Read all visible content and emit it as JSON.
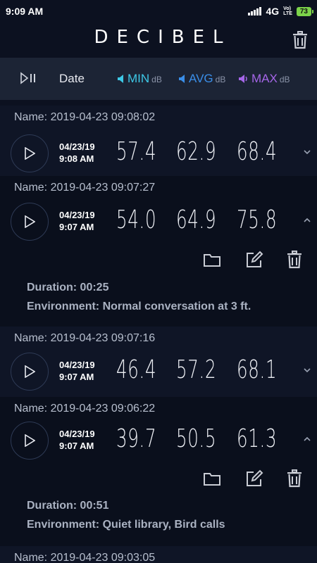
{
  "status_bar": {
    "time": "9:09 AM",
    "network": "4G",
    "volte_line1": "Vo)",
    "volte_line2": "LTE",
    "battery": "73"
  },
  "header": {
    "app_title": "DECIBEL"
  },
  "columns": {
    "date_label": "Date",
    "min_label": "MIN",
    "avg_label": "AVG",
    "max_label": "MAX",
    "unit": "dB"
  },
  "colors": {
    "min": "#3dc8e6",
    "avg": "#3a8ee8",
    "max": "#a566e8"
  },
  "recordings": [
    {
      "name": "Name: 2019-04-23 09:08:02",
      "date": "04/23/19",
      "time": "9:08 AM",
      "min": "57.4",
      "avg": "62.9",
      "max": "68.4",
      "expanded": false
    },
    {
      "name": "Name: 2019-04-23 09:07:27",
      "date": "04/23/19",
      "time": "9:07 AM",
      "min": "54.0",
      "avg": "64.9",
      "max": "75.8",
      "expanded": true,
      "duration": "Duration: 00:25",
      "environment": "Environment: Normal conversation at 3 ft."
    },
    {
      "name": "Name: 2019-04-23 09:07:16",
      "date": "04/23/19",
      "time": "9:07 AM",
      "min": "46.4",
      "avg": "57.2",
      "max": "68.1",
      "expanded": false
    },
    {
      "name": "Name: 2019-04-23 09:06:22",
      "date": "04/23/19",
      "time": "9:07 AM",
      "min": "39.7",
      "avg": "50.5",
      "max": "61.3",
      "expanded": true,
      "duration": "Duration: 00:51",
      "environment": "Environment: Quiet library, Bird calls"
    },
    {
      "name": "Name: 2019-04-23 09:03:05"
    }
  ]
}
